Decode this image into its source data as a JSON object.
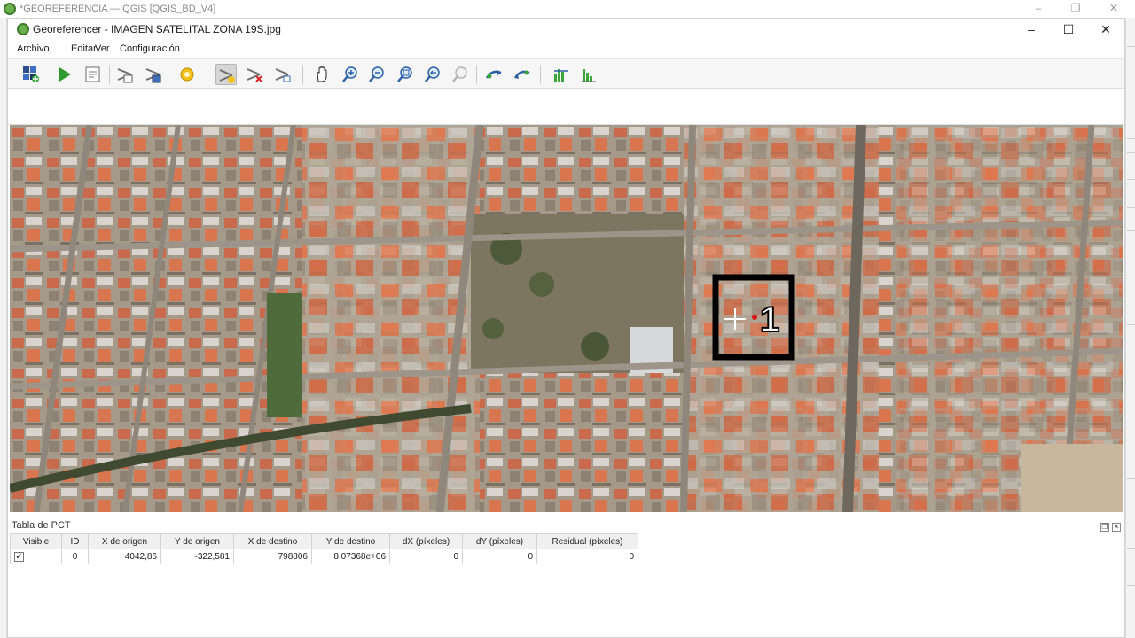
{
  "background_window": {
    "title": "*GEOREFERENCIA — QGIS [QGIS_BD_V4]",
    "controls": [
      "minimize",
      "restore",
      "close"
    ]
  },
  "window": {
    "title": "Georeferencer - IMAGEN SATELITAL ZONA 19S.jpg",
    "controls": [
      "minimize",
      "maximize",
      "close"
    ]
  },
  "menu": [
    "Archivo",
    "Editar",
    "Ver",
    "Configuración"
  ],
  "toolbar": {
    "buttons": [
      {
        "name": "open-raster-icon"
      },
      {
        "name": "start-georeferencing-icon"
      },
      {
        "name": "generate-gdal-script-icon"
      },
      {
        "name": "load-gcp-points-icon"
      },
      {
        "name": "save-gcp-points-icon"
      },
      {
        "name": "transformation-settings-icon"
      },
      {
        "name": "add-point-icon",
        "active": true
      },
      {
        "name": "delete-point-icon"
      },
      {
        "name": "move-gcp-point-icon"
      },
      {
        "name": "pan-icon"
      },
      {
        "name": "zoom-in-icon"
      },
      {
        "name": "zoom-out-icon"
      },
      {
        "name": "zoom-to-layer-icon"
      },
      {
        "name": "zoom-last-icon"
      },
      {
        "name": "zoom-next-icon"
      },
      {
        "name": "link-georeferencer-to-qgis-icon"
      },
      {
        "name": "link-qgis-to-georeferencer-icon"
      },
      {
        "name": "full-histogram-stretch-icon"
      },
      {
        "name": "local-histogram-stretch-icon"
      }
    ]
  },
  "canvas": {
    "gcp_marker_label": "1"
  },
  "gcp_table": {
    "title": "Tabla de PCT",
    "headers": [
      "Visible",
      "ID",
      "X de origen",
      "Y de origen",
      "X de destino",
      "Y de destino",
      "dX (píxeles)",
      "dY (píxeles)",
      "Residual (píxeles)"
    ],
    "rows": [
      {
        "visible": "✓",
        "id": "0",
        "x_origin": "4042,86",
        "y_origin": "-322,581",
        "x_dest": "798806",
        "y_dest": "8,07368e+06",
        "dx": "0",
        "dy": "0",
        "residual": "0"
      }
    ]
  },
  "colors": {
    "accent_green": "#3d7a2a",
    "toolbar_bg": "#f6f6f6"
  }
}
